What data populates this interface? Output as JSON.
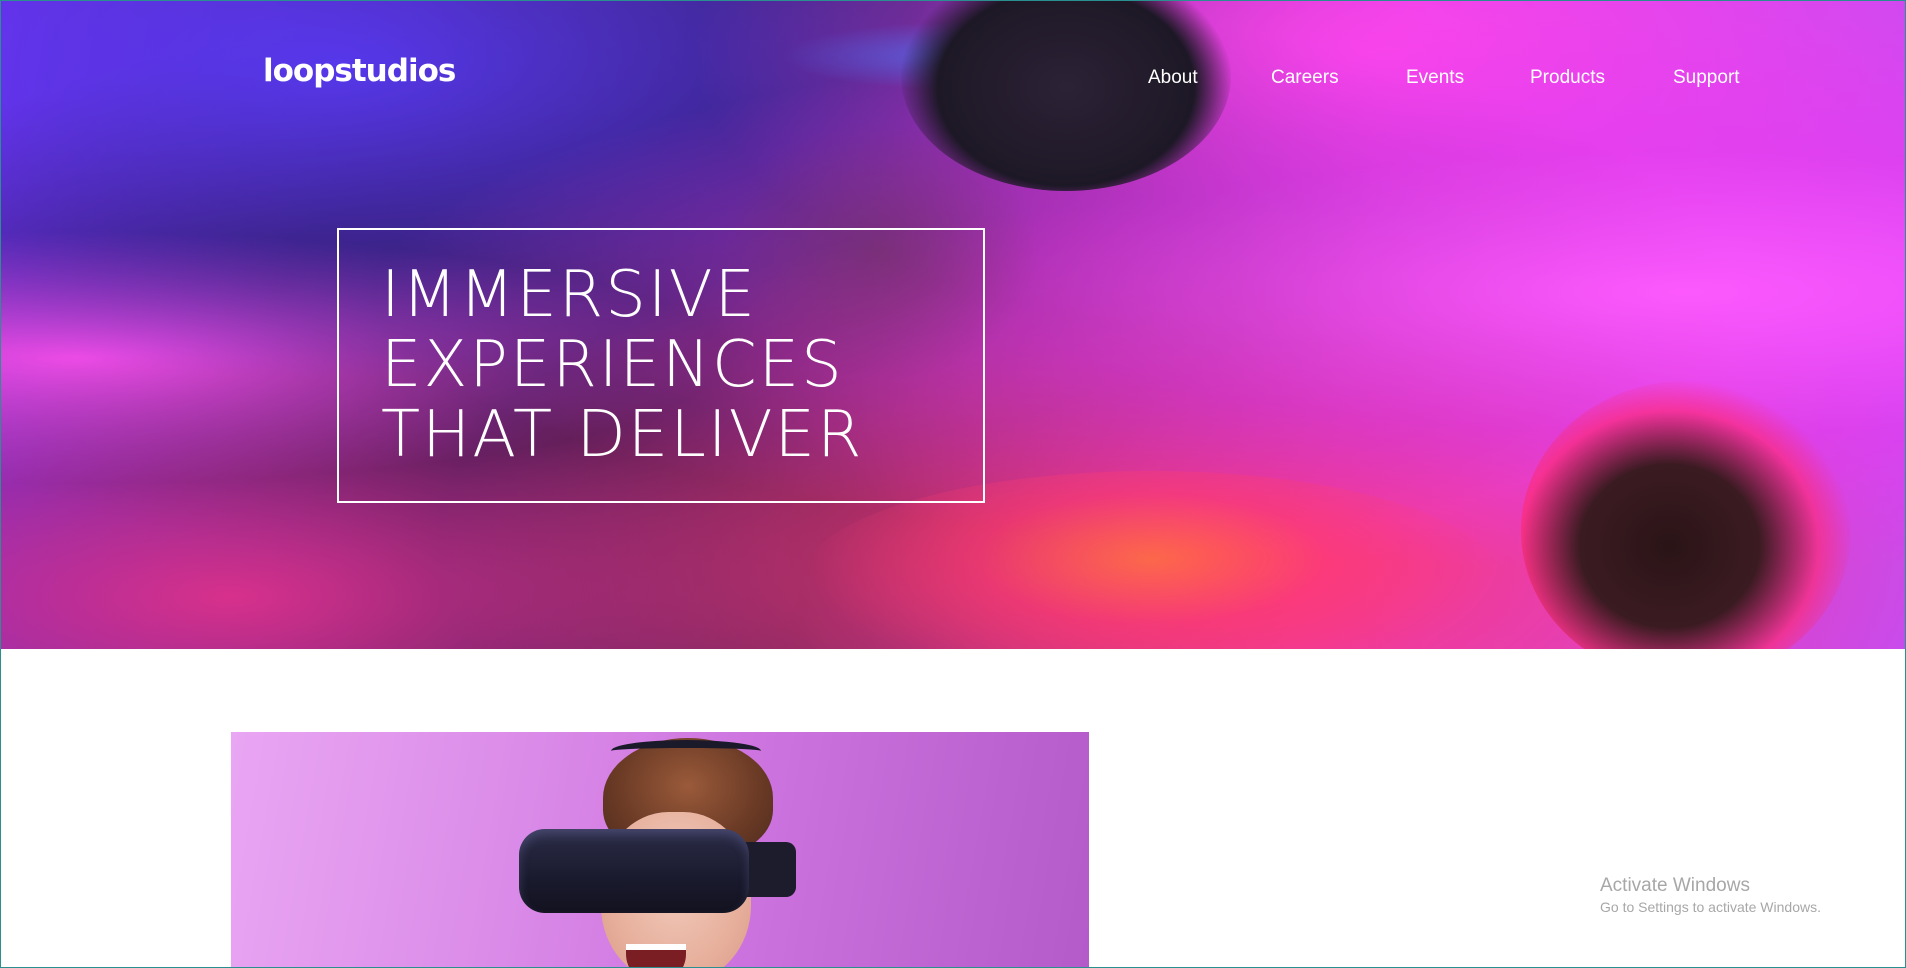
{
  "header": {
    "logo_text": "loopstudios",
    "nav": [
      {
        "label": "About"
      },
      {
        "label": "Careers"
      },
      {
        "label": "Events"
      },
      {
        "label": "Products"
      },
      {
        "label": "Support"
      }
    ]
  },
  "hero": {
    "headline_lines": [
      "IMMERSIVE",
      "EXPERIENCES",
      "THAT DELIVER"
    ]
  },
  "watermark": {
    "title": "Activate Windows",
    "subtitle": "Go to Settings to activate Windows."
  },
  "colors": {
    "hero_accent_pink": "#e23bf0",
    "hero_accent_red": "#ff3b6e",
    "hero_dark": "#2b1a4a",
    "text_white": "#ffffff",
    "vr_background": "#dc8ee9",
    "watermark_text": "#8a8a8a"
  }
}
